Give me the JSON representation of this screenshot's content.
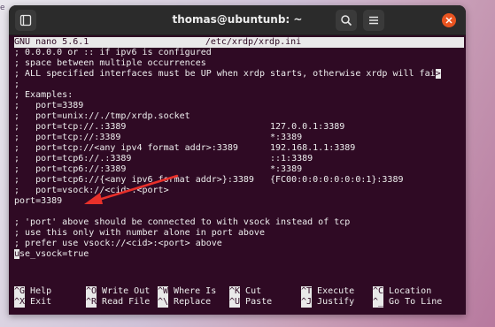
{
  "window": {
    "title": "thomas@ubuntunb: ~"
  },
  "nano_header": {
    "version": "GNU nano 5.6.1",
    "filename": "/etc/xrdp/xrdp.ini"
  },
  "file_lines": [
    "; 0.0.0.0 or :: if ipv6 is configured",
    "; space between multiple occurrences",
    "; ALL specified interfaces must be UP when xrdp starts, otherwise xrdp will fai",
    ";",
    "; Examples:",
    ";   port=3389",
    ";   port=unix://./tmp/xrdp.socket",
    ";   port=tcp://.:3389                           127.0.0.1:3389",
    ";   port=tcp://:3389                            *:3389",
    ";   port=tcp://<any ipv4 format addr>:3389      192.168.1.1:3389",
    ";   port=tcp6://.:3389                          ::1:3389",
    ";   port=tcp6://:3389                           *:3389",
    ";   port=tcp6://{<any ipv6 format addr>}:3389   {FC00:0:0:0:0:0:0:1}:3389",
    ";   port=vsock://<cid>:<port>",
    "port=3389",
    "",
    "; 'port' above should be connected to with vsock instead of tcp",
    "; use this only with number alone in port above",
    "; prefer use vsock://<cid>:<port> above"
  ],
  "truncation_marker": ">",
  "cursor_line": {
    "cursor_char": "u",
    "rest": "se_vsock=true"
  },
  "shortcuts": [
    [
      {
        "key": "^G",
        "label": "Help"
      },
      {
        "key": "^O",
        "label": "Write Out"
      },
      {
        "key": "^W",
        "label": "Where Is"
      },
      {
        "key": "^K",
        "label": "Cut"
      },
      {
        "key": "^T",
        "label": "Execute"
      },
      {
        "key": "^C",
        "label": "Location"
      }
    ],
    [
      {
        "key": "^X",
        "label": "Exit"
      },
      {
        "key": "^R",
        "label": "Read File"
      },
      {
        "key": "^\\",
        "label": "Replace"
      },
      {
        "key": "^U",
        "label": "Paste"
      },
      {
        "key": "^J",
        "label": "Justify"
      },
      {
        "key": "^_",
        "label": "Go To Line"
      }
    ]
  ],
  "background_fragment": "e",
  "colors": {
    "terminal_bg": "#2f0a24",
    "titlebar_bg": "#2b2b2b",
    "close_button": "#e95420",
    "annotation_arrow": "#e8302a"
  },
  "icons": {
    "new_tab": "new-tab-icon",
    "search": "search-icon",
    "menu": "hamburger-menu-icon",
    "close": "close-icon"
  }
}
